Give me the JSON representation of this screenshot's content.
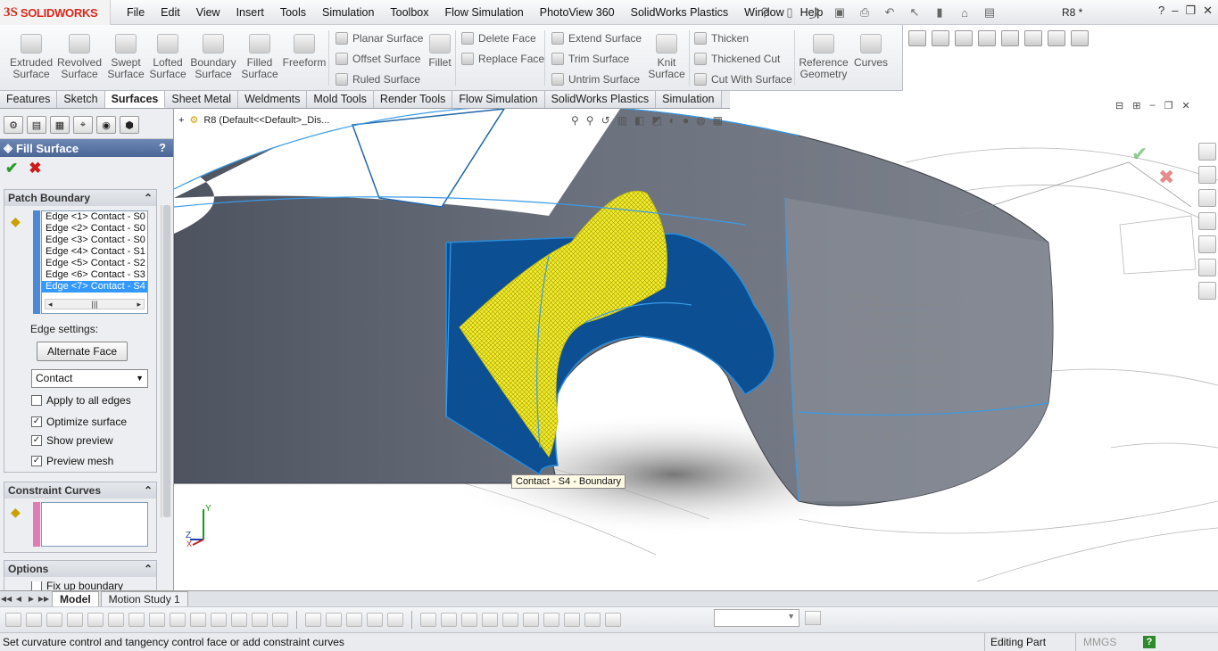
{
  "app": {
    "logo_brand": "3S",
    "logo_name": "SOLIDWORKS",
    "doc_title": "R8 *"
  },
  "menu": [
    "File",
    "Edit",
    "View",
    "Insert",
    "Tools",
    "Simulation",
    "Toolbox",
    "Flow Simulation",
    "PhotoView 360",
    "SolidWorks Plastics",
    "Window",
    "Help"
  ],
  "commands": {
    "extruded": "Extruded Surface",
    "revolved": "Revolved Surface",
    "swept": "Swept Surface",
    "lofted": "Lofted Surface",
    "boundary": "Boundary Surface",
    "filled": "Filled Surface",
    "freeform": "Freeform",
    "planar": "Planar Surface",
    "offset": "Offset Surface",
    "ruled": "Ruled Surface",
    "fillet": "Fillet",
    "delete_face": "Delete Face",
    "replace_face": "Replace Face",
    "extend": "Extend Surface",
    "trim": "Trim Surface",
    "untrim": "Untrim Surface",
    "knit": "Knit Surface",
    "thicken": "Thicken",
    "thickened_cut": "Thickened Cut",
    "cut_with": "Cut With Surface",
    "ref_geom": "Reference Geometry",
    "curves": "Curves"
  },
  "tabs": [
    "Features",
    "Sketch",
    "Surfaces",
    "Sheet Metal",
    "Weldments",
    "Mold Tools",
    "Render Tools",
    "Flow Simulation",
    "SolidWorks Plastics",
    "Simulation"
  ],
  "active_tab": "Surfaces",
  "panel": {
    "title": "Fill Surface",
    "help": "?",
    "ok": "✔",
    "cancel": "✖",
    "patch_boundary": "Patch Boundary",
    "edges": [
      "Edge <1> Contact - S0",
      "Edge <2> Contact - S0",
      "Edge <3> Contact - S0",
      "Edge <4> Contact - S1",
      "Edge <5> Contact - S2",
      "Edge <6> Contact - S3",
      "Edge <7> Contact - S4"
    ],
    "edge_settings": "Edge settings:",
    "alternate_face": "Alternate Face",
    "contact_value": "Contact",
    "apply_all": "Apply to all edges",
    "optimize": "Optimize surface",
    "show_preview": "Show preview",
    "preview_mesh": "Preview mesh",
    "constraint_curves": "Constraint Curves",
    "options": "Options",
    "fix_boundary": "Fix up boundary"
  },
  "viewport": {
    "tree_label": "R8  (Default<<Default>_Dis...",
    "tooltip": "Contact - S4 - Boundary",
    "axis_y": "Y",
    "axis_z": "Z",
    "axis_x": "X"
  },
  "bottom_tabs": [
    "Model",
    "Motion Study 1"
  ],
  "status": {
    "message": "Set curvature control and tangency control face or add constraint curves",
    "mode": "Editing Part",
    "units": "MMGS",
    "help": "?"
  }
}
